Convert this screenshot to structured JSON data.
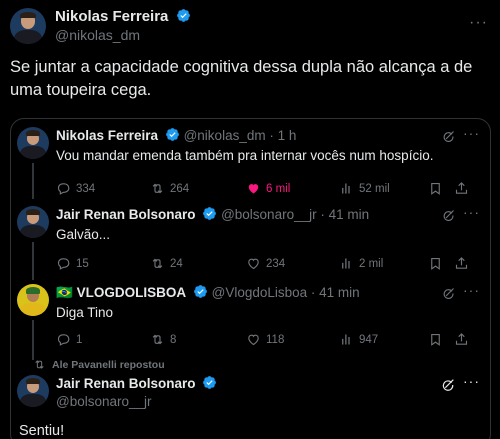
{
  "main_tweet": {
    "display_name": "Nikolas Ferreira",
    "handle": "@nikolas_dm",
    "text": "Se juntar a capacidade cognitiva dessa dupla não alcança a de uma toupeira cega."
  },
  "quoted": [
    {
      "display_name": "Nikolas Ferreira",
      "handle_time": "@nikolas_dm · 1 h",
      "text": "Vou mandar emenda também pra internar vocês num hospício.",
      "replies": "334",
      "reposts": "264",
      "likes": "6 mil",
      "views": "52 mil"
    },
    {
      "display_name": "Jair Renan Bolsonaro",
      "handle_time": "@bolsonaro__jr · 41 min",
      "text": "Galvão...",
      "replies": "15",
      "reposts": "24",
      "likes": "234",
      "views": "2 mil"
    },
    {
      "display_name": "VLOGDOLISBOA",
      "flag": "🇧🇷",
      "handle_time": "@VlogdoLisboa · 41 min",
      "text": "Diga Tino",
      "replies": "1",
      "reposts": "8",
      "likes": "118",
      "views": "947"
    }
  ],
  "repost_note": "Ale Pavanelli repostou",
  "last_tweet": {
    "display_name": "Jair Renan Bolsonaro",
    "handle": "@bolsonaro__jr",
    "text": "Sentiu!"
  },
  "colors": {
    "verified": "#1d9bf0",
    "like": "#f91880",
    "muted": "#71767b",
    "border": "#2f3336"
  }
}
